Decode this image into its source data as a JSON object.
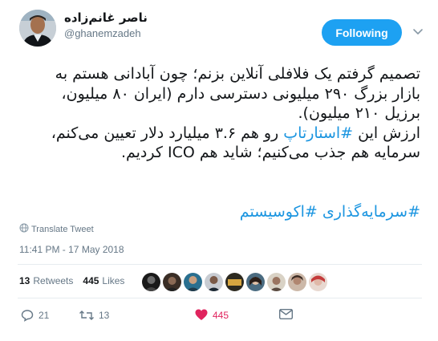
{
  "author": {
    "name": "ناصر غانم‌زاده",
    "handle": "@ghanemzadeh"
  },
  "follow_button": {
    "label": "Following"
  },
  "tweet": {
    "lines": [
      {
        "text": "تصمیم گرفتم یک فلافلی آنلاین بزنم؛ چون آبادانی هستم به"
      },
      {
        "text": "بازار بزرگ ۲۹۰ میلیونی دسترسی دارم (ایران ۸۰ میلیون،"
      },
      {
        "text": "برزیل ۲۱۰ میلیون)."
      },
      {
        "pre": "ارزش این ",
        "link": "#استارتاپ",
        "post": " رو هم ۳.۶ میلیارد دلار تعیین می‌کنم،"
      },
      {
        "text": "سرمایه هم جذب می‌کنیم؛ شاید هم ICO کردیم."
      }
    ],
    "hashtags": "#سرمایه‌گذاری #اکوسیستم"
  },
  "translate_label": "Translate Tweet",
  "timestamp": "11:41 PM - 17 May 2018",
  "stats": {
    "retweets_count": "13",
    "retweets_label": "Retweets",
    "likes_count": "445",
    "likes_label": "Likes"
  },
  "actions": {
    "reply_count": "21",
    "retweet_count": "13",
    "like_count": "445"
  },
  "icons": {
    "reply": "reply-icon",
    "retweet": "retweet-icon",
    "like": "heart-icon",
    "dm": "envelope-icon",
    "translate": "globe-icon",
    "caret": "chevron-down-icon"
  },
  "colors": {
    "accent": "#1da1f2",
    "link": "#1b95e0",
    "like": "#e0245e",
    "muted": "#657786"
  }
}
